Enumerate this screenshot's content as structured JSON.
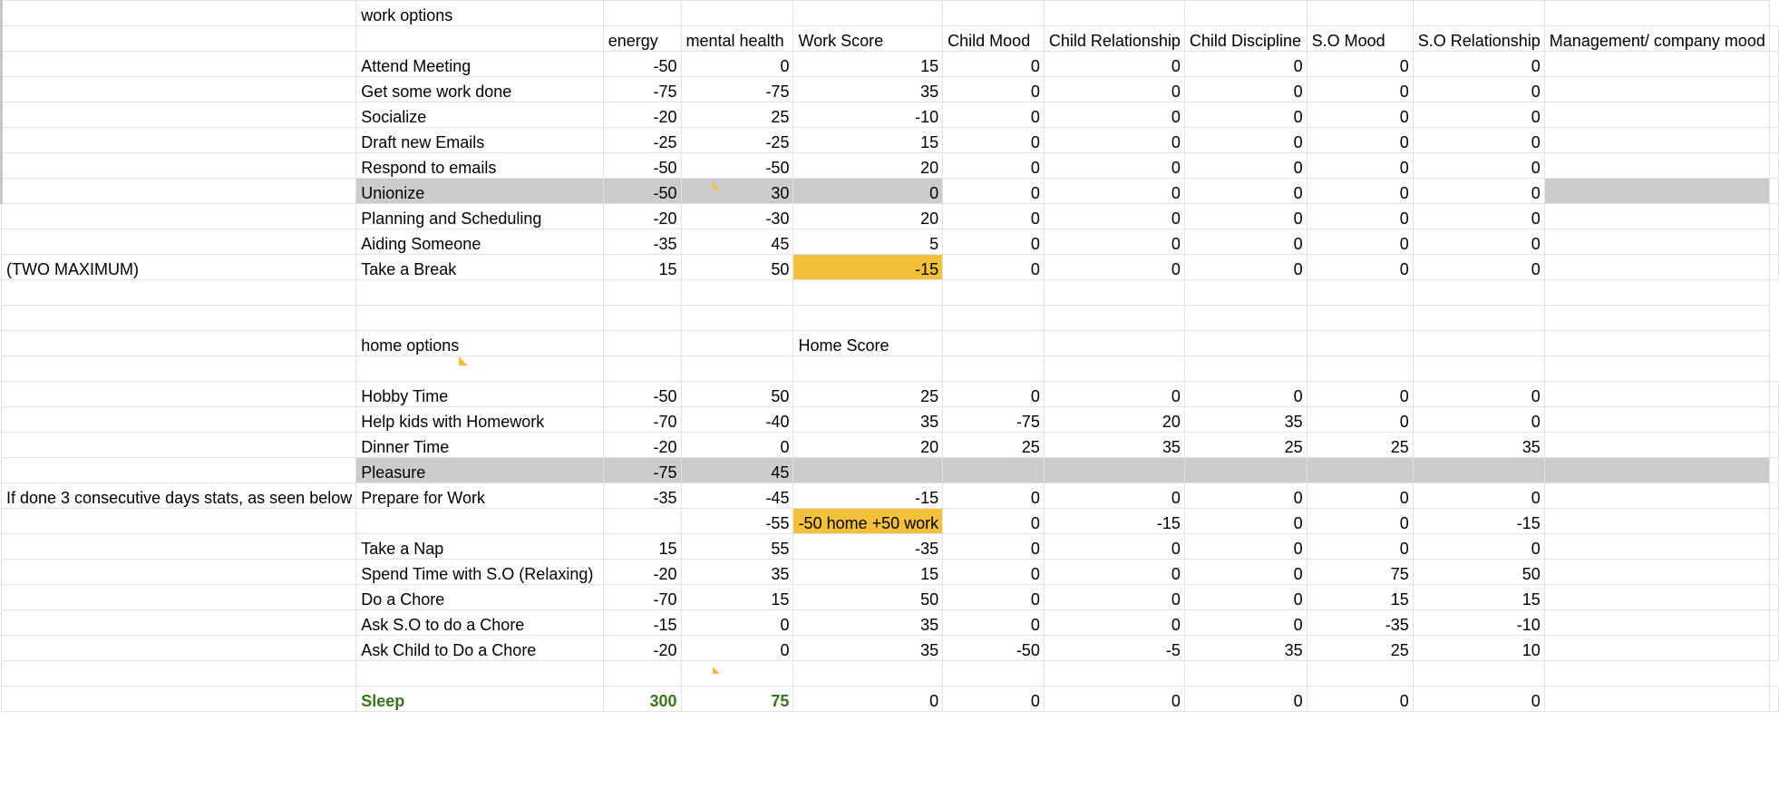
{
  "work": {
    "title": "work options",
    "headers": [
      "energy",
      "mental health",
      "Work Score",
      "Child Mood",
      "Child Relationship",
      "Child Discipline",
      "S.O Mood",
      "S.O  Relationship",
      "Management/ company mood"
    ],
    "rows": [
      {
        "name": "Attend Meeting",
        "values": [
          "-50",
          "0",
          "15",
          "0",
          "0",
          "0",
          "0",
          "0"
        ]
      },
      {
        "name": "Get some work done",
        "values": [
          "-75",
          "-75",
          "35",
          "0",
          "0",
          "0",
          "0",
          "0"
        ]
      },
      {
        "name": "Socialize",
        "values": [
          "-20",
          "25",
          "-10",
          "0",
          "0",
          "0",
          "0",
          "0"
        ]
      },
      {
        "name": "Draft new Emails",
        "values": [
          "-25",
          "-25",
          "15",
          "0",
          "0",
          "0",
          "0",
          "0"
        ]
      },
      {
        "name": "Respond to emails",
        "values": [
          "-50",
          "-50",
          "20",
          "0",
          "0",
          "0",
          "0",
          "0"
        ]
      },
      {
        "name": "Unionize",
        "values": [
          "-50",
          "30",
          "0",
          "0",
          "0",
          "0",
          "0",
          "0"
        ]
      },
      {
        "name": "Planning and Scheduling",
        "values": [
          "-20",
          "-30",
          "20",
          "0",
          "0",
          "0",
          "0",
          "0"
        ]
      },
      {
        "name": "Aiding Someone",
        "values": [
          "-35",
          "45",
          "5",
          "0",
          "0",
          "0",
          "0",
          "0"
        ]
      },
      {
        "name": "Take a Break",
        "note": "(TWO MAXIMUM)",
        "values": [
          "15",
          "50",
          "-15",
          "0",
          "0",
          "0",
          "0",
          "0"
        ]
      }
    ]
  },
  "home": {
    "title": "home options",
    "score_header": "Home Score",
    "rows": [
      {
        "name": "Hobby Time",
        "values": [
          "-50",
          "50",
          "25",
          "0",
          "0",
          "0",
          "0",
          "0"
        ]
      },
      {
        "name": "Help kids with Homework",
        "values": [
          "-70",
          "-40",
          "35",
          "-75",
          "20",
          "35",
          "0",
          "0"
        ]
      },
      {
        "name": "Dinner Time",
        "values": [
          "-20",
          "0",
          "20",
          "25",
          "35",
          "25",
          "25",
          "35"
        ]
      },
      {
        "name": "Pleasure",
        "values": [
          "-75",
          "45"
        ]
      },
      {
        "name": "Prepare for Work",
        "note": "If done 3 consecutive days stats, as seen below",
        "values": [
          "-35",
          "-45",
          "-15",
          "0",
          "0",
          "0",
          "0",
          "0"
        ]
      },
      {
        "name": "",
        "values": [
          "",
          "-55",
          "-50 home +50 work",
          "0",
          "-15",
          "0",
          "0",
          "-15"
        ]
      },
      {
        "name": "Take a Nap",
        "values": [
          "15",
          "55",
          "-35",
          "0",
          "0",
          "0",
          "0",
          "0"
        ]
      },
      {
        "name": "Spend Time with S.O (Relaxing)",
        "values": [
          "-20",
          "35",
          "15",
          "0",
          "0",
          "0",
          "75",
          "50"
        ]
      },
      {
        "name": "Do a Chore",
        "values": [
          "-70",
          "15",
          "50",
          "0",
          "0",
          "0",
          "15",
          "15"
        ]
      },
      {
        "name": "Ask S.O to do a Chore",
        "values": [
          "-15",
          "0",
          "35",
          "0",
          "0",
          "0",
          "-35",
          "-10"
        ]
      },
      {
        "name": "Ask Child to Do a Chore",
        "values": [
          "-20",
          "0",
          "35",
          "-50",
          "-5",
          "35",
          "25",
          "10"
        ]
      },
      {
        "name": "Sleep",
        "values": [
          "300",
          "75",
          "0",
          "0",
          "0",
          "0",
          "0",
          "0"
        ]
      }
    ]
  },
  "colors": {
    "highlight": "#f5c03b",
    "gray_row": "#cccccc",
    "sleep_text": "#38761d"
  }
}
